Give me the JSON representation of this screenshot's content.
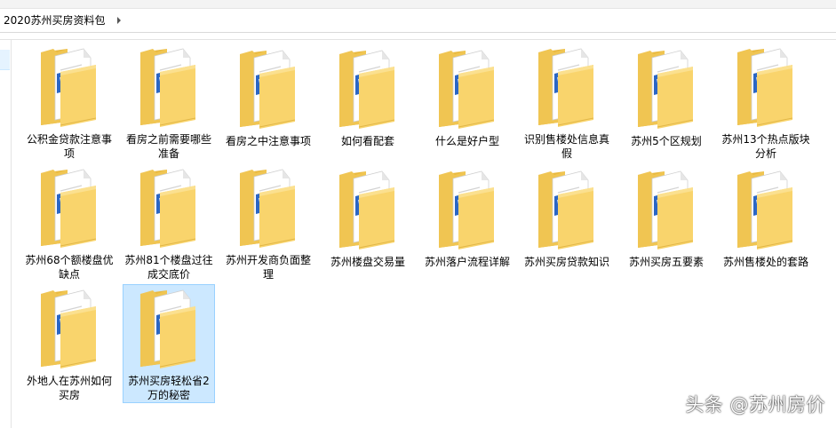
{
  "address": {
    "crumb": "2020苏州买房资料包"
  },
  "colors": {
    "selection_bg": "#cce8ff",
    "selection_border": "#99d1ff",
    "folder_body": "#f9d46c",
    "word_blue": "#2b66c4"
  },
  "items": [
    {
      "label": "公积金贷款注意事项",
      "icon": "folder-with-word-document-icon",
      "selected": false
    },
    {
      "label": "看房之前需要哪些准备",
      "icon": "folder-with-word-document-icon",
      "selected": false
    },
    {
      "label": "看房之中注意事项",
      "icon": "folder-with-word-document-icon",
      "selected": false
    },
    {
      "label": "如何看配套",
      "icon": "folder-with-word-document-icon",
      "selected": false
    },
    {
      "label": "什么是好户型",
      "icon": "folder-with-word-document-icon",
      "selected": false
    },
    {
      "label": "识别售楼处信息真假",
      "icon": "folder-with-word-document-icon",
      "selected": false
    },
    {
      "label": "苏州5个区规划",
      "icon": "folder-with-word-document-icon",
      "selected": false
    },
    {
      "label": "苏州13个热点版块分析",
      "icon": "folder-with-word-document-icon",
      "selected": false
    },
    {
      "label": "苏州68个额楼盘优缺点",
      "icon": "folder-with-word-document-icon",
      "selected": false
    },
    {
      "label": "苏州81个楼盘过往成交底价",
      "icon": "folder-with-word-document-icon",
      "selected": false
    },
    {
      "label": "苏州开发商负面整理",
      "icon": "folder-with-word-document-icon",
      "selected": false
    },
    {
      "label": "苏州楼盘交易量",
      "icon": "folder-with-word-document-icon",
      "selected": false
    },
    {
      "label": "苏州落户流程详解",
      "icon": "folder-with-word-document-icon",
      "selected": false
    },
    {
      "label": "苏州买房贷款知识",
      "icon": "folder-with-word-document-icon",
      "selected": false
    },
    {
      "label": "苏州买房五要素",
      "icon": "folder-with-word-document-icon",
      "selected": false
    },
    {
      "label": "苏州售楼处的套路",
      "icon": "folder-with-word-document-icon",
      "selected": false
    },
    {
      "label": "外地人在苏州如何买房",
      "icon": "folder-with-word-document-icon",
      "selected": false
    },
    {
      "label": "苏州买房轻松省2万的秘密",
      "icon": "folder-with-word-document-icon",
      "selected": true
    }
  ],
  "watermark": {
    "text": "头条 @苏州房价"
  }
}
